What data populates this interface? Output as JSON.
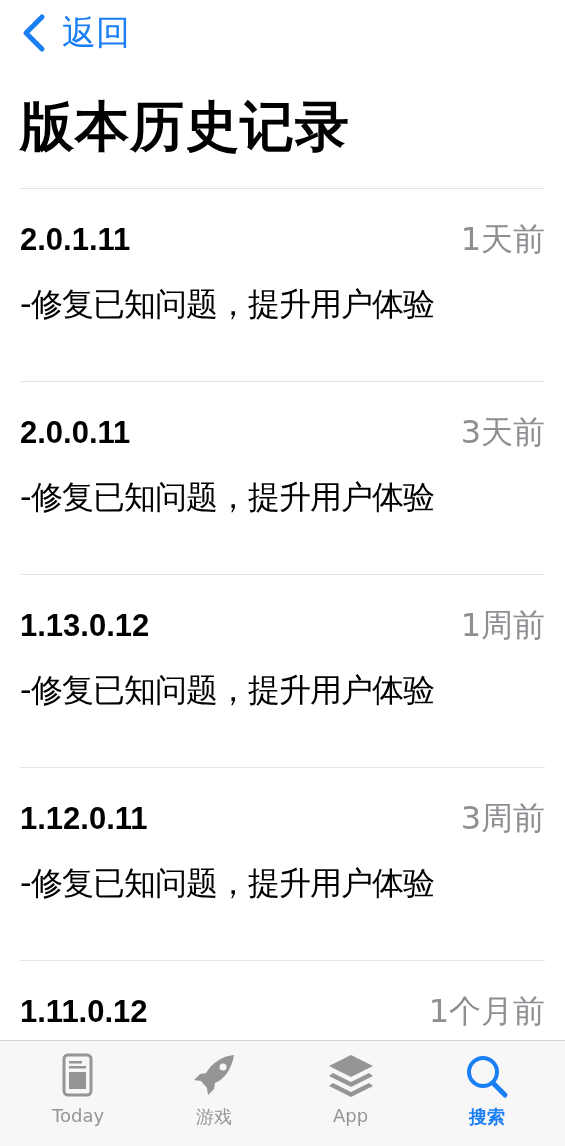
{
  "nav": {
    "back": "返回"
  },
  "title": "版本历史记录",
  "versions": [
    {
      "version": "2.0.1.11",
      "date": "1天前",
      "notes": "-修复已知问题，提升用户体验"
    },
    {
      "version": "2.0.0.11",
      "date": "3天前",
      "notes": "-修复已知问题，提升用户体验"
    },
    {
      "version": "1.13.0.12",
      "date": "1周前",
      "notes": "-修复已知问题，提升用户体验"
    },
    {
      "version": "1.12.0.11",
      "date": "3周前",
      "notes": "-修复已知问题，提升用户体验"
    },
    {
      "version": "1.11.0.12",
      "date": "1个月前"
    }
  ],
  "tab_bar": [
    {
      "kind": "today",
      "label": "Today",
      "selected": false
    },
    {
      "kind": "games",
      "label": "游戏",
      "selected": false
    },
    {
      "kind": "apps",
      "label": "App",
      "selected": false
    },
    {
      "kind": "search",
      "label": "搜索",
      "selected": true
    }
  ]
}
